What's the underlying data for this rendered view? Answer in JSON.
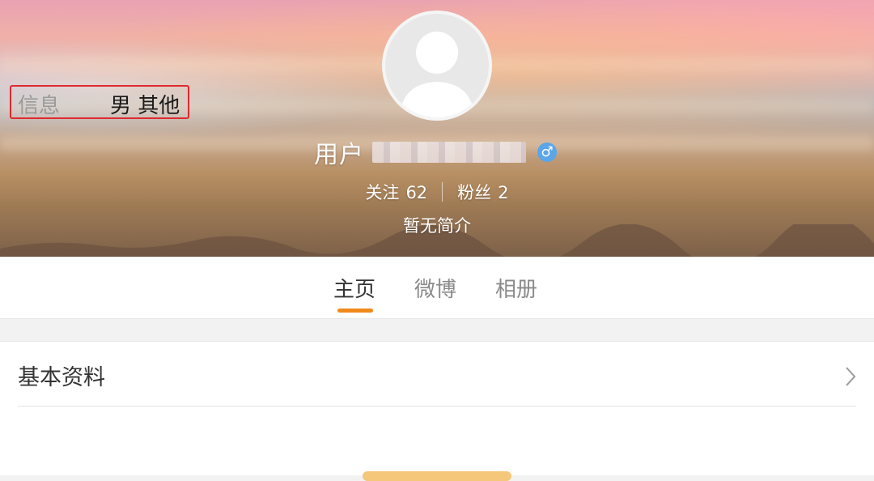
{
  "profile": {
    "username_prefix": "用户",
    "gender_symbol": "♂",
    "following_label": "关注",
    "following_count": "62",
    "followers_label": "粉丝",
    "followers_count": "2",
    "bio": "暂无简介"
  },
  "tabs": [
    {
      "label": "主页",
      "active": true
    },
    {
      "label": "微博",
      "active": false
    },
    {
      "label": "相册",
      "active": false
    }
  ],
  "basic_info": {
    "title": "基本资料",
    "info_label": "信息",
    "info_value": "男 其他"
  },
  "colors": {
    "accent": "#f08a1a",
    "gender_badge": "#5aa6e8",
    "highlight_box": "#e0292f"
  },
  "icons": {
    "avatar": "default-avatar-icon",
    "gender": "male-icon",
    "chevron": "chevron-right-icon"
  }
}
